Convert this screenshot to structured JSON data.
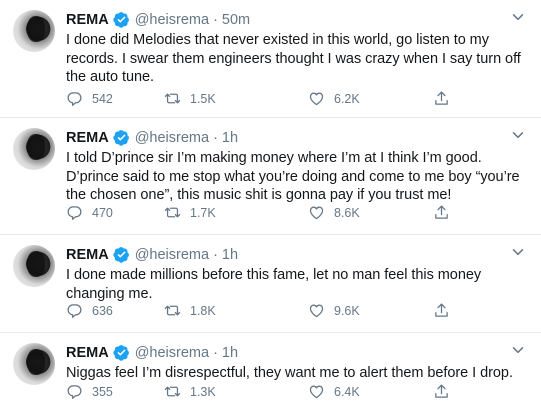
{
  "tweets": [
    {
      "name": "REMA",
      "handle": "@heisrema",
      "dot": "·",
      "time": "50m",
      "text": "I done did Melodies that never existed in this world, go listen to my records. I swear them engineers thought I was crazy when I say turn off the auto tune.",
      "replies": "542",
      "retweets": "1.5K",
      "likes": "6.2K"
    },
    {
      "name": "REMA",
      "handle": "@heisrema",
      "dot": "·",
      "time": "1h",
      "text": "I told D’prince sir I’m making money where I’m at I think I’m good. D’prince said to me stop what you’re doing and come to me boy “you’re the chosen one”, this music shit is gonna pay if you trust me!",
      "replies": "470",
      "retweets": "1.7K",
      "likes": "8.6K"
    },
    {
      "name": "REMA",
      "handle": "@heisrema",
      "dot": "·",
      "time": "1h",
      "text": "I done made millions before this fame, let no man feel this money changing me.",
      "replies": "636",
      "retweets": "1.8K",
      "likes": "9.6K"
    },
    {
      "name": "REMA",
      "handle": "@heisrema",
      "dot": "·",
      "time": "1h",
      "text": "Niggas feel I’m disrespectful, they want me to alert them before I drop.",
      "replies": "355",
      "retweets": "1.3K",
      "likes": "6.4K"
    }
  ],
  "icons": {
    "verified": "verified-badge-icon",
    "caret": "chevron-down-icon",
    "reply": "reply-icon",
    "retweet": "retweet-icon",
    "like": "heart-icon",
    "share": "share-icon"
  },
  "colors": {
    "accent": "#1da1f2",
    "text": "#14171a",
    "muted": "#657786",
    "divider": "#e6ecf0"
  }
}
